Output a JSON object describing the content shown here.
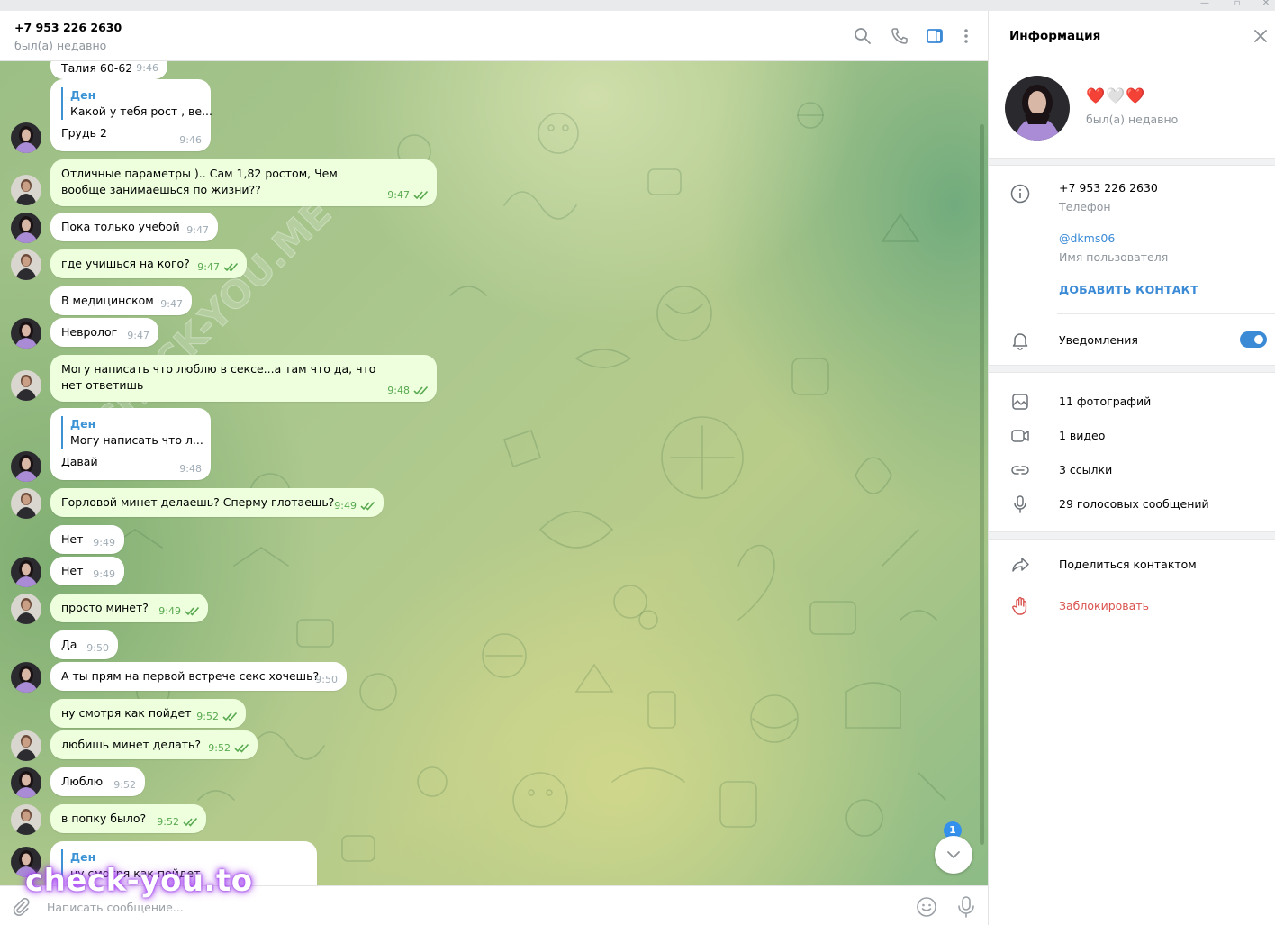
{
  "header": {
    "contact_name": "+7 953 226 2630",
    "status": "был(а) недавно"
  },
  "messages": [
    {
      "side": "in",
      "text": "Талия 60-62",
      "time": "9:46"
    },
    {
      "side": "in",
      "reply_name": "Ден",
      "reply_text": "Какой у тебя рост , ве...",
      "text": "Грудь 2",
      "time": "9:46"
    },
    {
      "side": "out",
      "text": "Отличные параметры ).. Сам 1,82 ростом, Чем вообще занимаешься по жизни??",
      "time": "9:47"
    },
    {
      "side": "in",
      "text": "Пока только учебой",
      "time": "9:47"
    },
    {
      "side": "out",
      "text": "где учишься на кого?",
      "time": "9:47"
    },
    {
      "side": "in",
      "text": "В медицинском",
      "time": "9:47"
    },
    {
      "side": "in",
      "text": "Невролог",
      "time": "9:47"
    },
    {
      "side": "out",
      "text": "Могу написать что люблю в сексе...а там что да, что нет ответишь",
      "time": "9:48"
    },
    {
      "side": "in",
      "reply_name": "Ден",
      "reply_text": "Могу написать что л...",
      "text": "Давай",
      "time": "9:48"
    },
    {
      "side": "out",
      "text": "Горловой минет делаешь? Сперму глотаешь?",
      "time": "9:49"
    },
    {
      "side": "in",
      "text": "Нет",
      "time": "9:49"
    },
    {
      "side": "in",
      "text": "Нет",
      "time": "9:49"
    },
    {
      "side": "out",
      "text": "просто минет?",
      "time": "9:49"
    },
    {
      "side": "in",
      "text": "Да",
      "time": "9:50"
    },
    {
      "side": "in",
      "text": "А ты прям на первой встрече секс хочешь?",
      "time": "9:50"
    },
    {
      "side": "out",
      "text": "ну смотря как пойдет",
      "time": "9:52"
    },
    {
      "side": "out",
      "text": "любишь минет делать?",
      "time": "9:52"
    },
    {
      "side": "in",
      "text": "Люблю",
      "time": "9:52"
    },
    {
      "side": "out",
      "text": "в попку было?",
      "time": "9:52"
    },
    {
      "side": "in",
      "reply_name": "Ден",
      "reply_text": "ну смотря как пойдет",
      "text": "",
      "time": ""
    }
  ],
  "scroll_down": {
    "unread_count": "1"
  },
  "composer": {
    "placeholder": "Написать сообщение..."
  },
  "overlay_watermarks": {
    "site": "check-you.to",
    "diagonal": "CHECK-YOU.ME"
  },
  "info_panel": {
    "title": "Информация",
    "profile_name": "❤️🤍❤️",
    "profile_status": "был(а) недавно",
    "phone": "+7 953 226 2630",
    "phone_label": "Телефон",
    "username": "@dkms06",
    "username_label": "Имя пользователя",
    "add_contact": "ДОБАВИТЬ КОНТАКТ",
    "notifications_label": "Уведомления",
    "notifications_on": true,
    "media": {
      "photos": "11 фотографий",
      "videos": "1 видео",
      "links": "3 ссылки",
      "voice": "29 голосовых сообщений"
    },
    "share_contact": "Поделиться контактом",
    "block": "Заблокировать"
  },
  "colors": {
    "accent": "#3a8ad6",
    "out_bubble": "#eeffde",
    "check_green": "#58a94f",
    "danger": "#d9534f"
  }
}
